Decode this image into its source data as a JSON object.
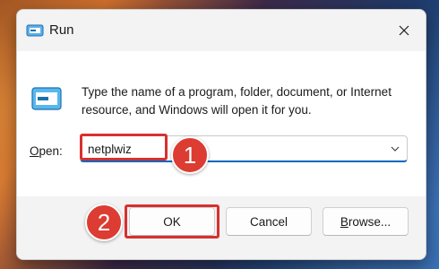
{
  "window": {
    "title": "Run",
    "description": "Type the name of a program, folder, document, or Internet resource, and Windows will open it for you."
  },
  "open_field": {
    "label_prefix": "O",
    "label_rest": "pen:",
    "value": "netplwiz"
  },
  "buttons": {
    "ok": "OK",
    "cancel": "Cancel",
    "browse_prefix": "B",
    "browse_rest": "rowse..."
  },
  "annotations": {
    "step1": "1",
    "step2": "2",
    "highlight_color": "#d9302e"
  },
  "colors": {
    "accent": "#0067c0",
    "badge": "#dc3c32"
  }
}
